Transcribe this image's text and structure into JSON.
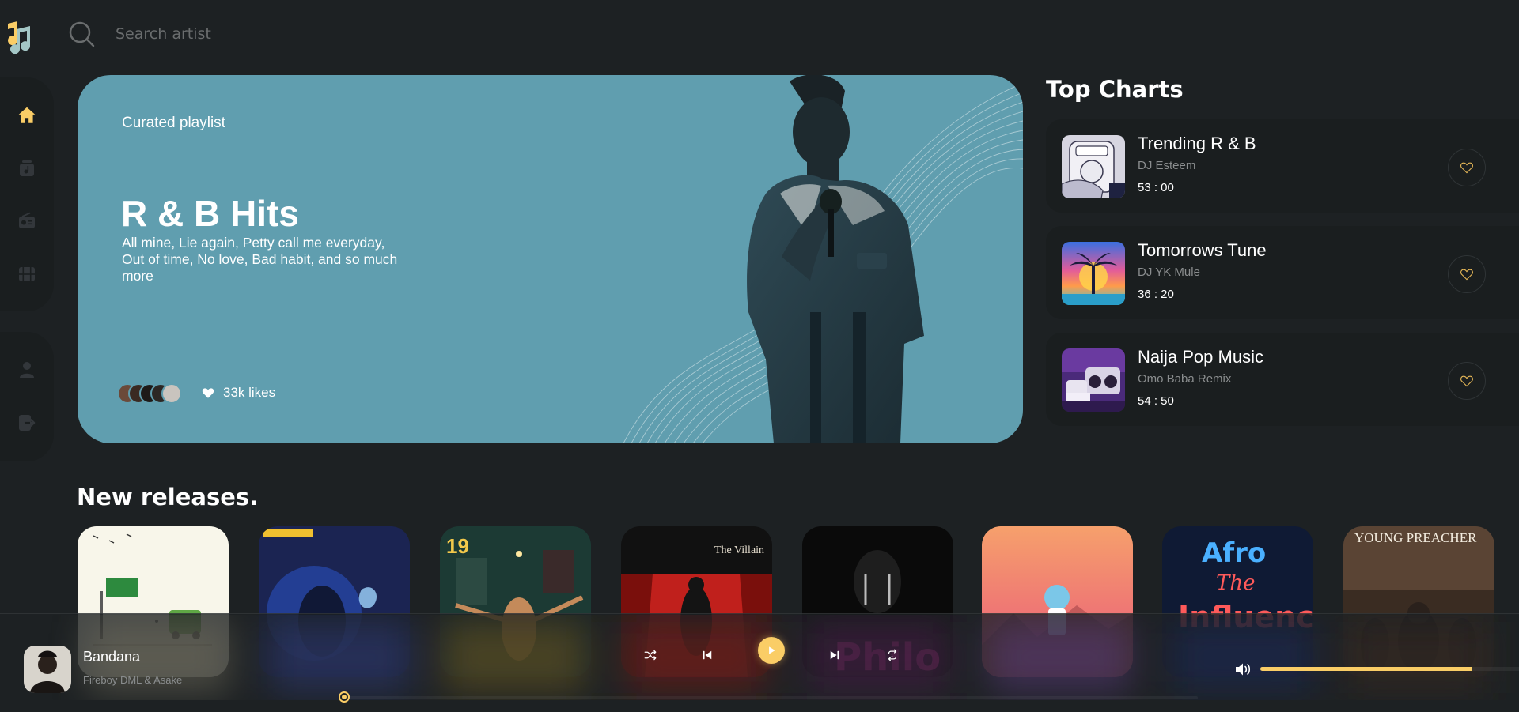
{
  "search": {
    "placeholder": "Search artist"
  },
  "sidebar": {
    "items": [
      {
        "name": "home",
        "icon": "home-icon",
        "active": true
      },
      {
        "name": "playlist",
        "icon": "music-library-icon",
        "active": false
      },
      {
        "name": "radio",
        "icon": "radio-icon",
        "active": false
      },
      {
        "name": "videos",
        "icon": "video-icon",
        "active": false
      },
      {
        "name": "profile",
        "icon": "user-icon",
        "active": false
      },
      {
        "name": "logout",
        "icon": "logout-icon",
        "active": false
      }
    ]
  },
  "hero": {
    "kicker": "Curated playlist",
    "title": "R & B Hits",
    "description": "All mine, Lie again, Petty call me everyday, Out of time, No love, Bad habit, and so much more",
    "likes": "33k likes"
  },
  "top_charts": {
    "title": "Top Charts",
    "items": [
      {
        "name": "Trending R & B",
        "artist": "DJ Esteem",
        "duration": "53 : 00"
      },
      {
        "name": "Tomorrows Tune",
        "artist": "DJ YK Mule",
        "duration": "36 : 20"
      },
      {
        "name": "Naija Pop Music",
        "artist": "Omo Baba Remix",
        "duration": "54 : 50"
      }
    ]
  },
  "new_releases": {
    "title": "New releases.",
    "covers": [
      "single-cover-1",
      "single-cover-2",
      "single-cover-3",
      "single-cover-4",
      "single-cover-5",
      "single-cover-6",
      "single-cover-7",
      "single-cover-8"
    ]
  },
  "player": {
    "title": "Bandana",
    "artist": "Fireboy DML & Asake",
    "progress": 0.0,
    "volume": 0.82
  },
  "colors": {
    "background": "#1d2123",
    "panel": "#1a1e1f",
    "accent": "#facd66",
    "hero": "#609eaf",
    "muted": "#8a8d8e"
  }
}
